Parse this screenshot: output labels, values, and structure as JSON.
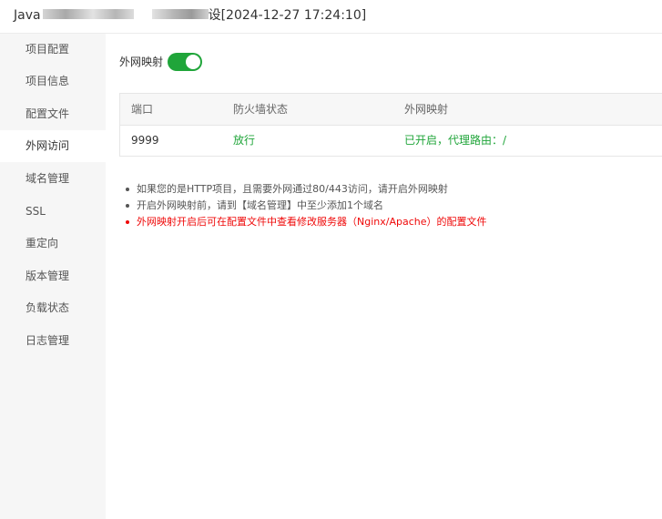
{
  "window": {
    "title_prefix": "Java",
    "title_suffix": "设[2024-12-27 17:24:10]"
  },
  "sidebar": {
    "active_index": 3,
    "items": [
      {
        "label": "项目配置"
      },
      {
        "label": "项目信息"
      },
      {
        "label": "配置文件"
      },
      {
        "label": "外网访问"
      },
      {
        "label": "域名管理"
      },
      {
        "label": "SSL"
      },
      {
        "label": "重定向"
      },
      {
        "label": "版本管理"
      },
      {
        "label": "负载状态"
      },
      {
        "label": "日志管理"
      }
    ]
  },
  "mapping": {
    "toggle_label": "外网映射",
    "enabled": true,
    "toggle_color": "#20a53a"
  },
  "table": {
    "headers": [
      "端口",
      "防火墙状态",
      "外网映射"
    ],
    "rows": [
      {
        "port": "9999",
        "firewall": "放行",
        "mapping": "已开启，代理路由：/"
      }
    ]
  },
  "tips": [
    {
      "text": "如果您的是HTTP项目，且需要外网通过80/443访问，请开启外网映射",
      "warning": false
    },
    {
      "text": "开启外网映射前，请到【域名管理】中至少添加1个域名",
      "warning": false
    },
    {
      "text": "外网映射开启后可在配置文件中查看修改服务器（Nginx/Apache）的配置文件",
      "warning": true
    }
  ],
  "colors": {
    "accent_green": "#20a53a",
    "warning_red": "#ef0808",
    "sidebar_bg": "#f6f6f6"
  }
}
